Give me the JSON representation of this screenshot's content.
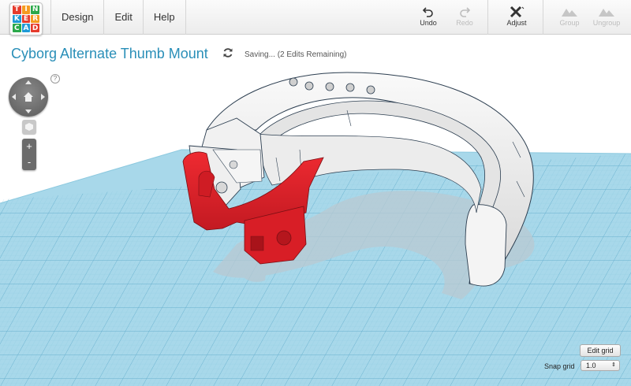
{
  "logo": {
    "letters": [
      "T",
      "I",
      "N",
      "K",
      "E",
      "R",
      "C",
      "A",
      "D"
    ],
    "colors": [
      "#e53b2c",
      "#f59b20",
      "#2aa84a",
      "#1f9ad6",
      "#e53b2c",
      "#f59b20",
      "#2aa84a",
      "#1f9ad6",
      "#e53b2c"
    ]
  },
  "menu": {
    "items": [
      {
        "label": "Design"
      },
      {
        "label": "Edit"
      },
      {
        "label": "Help"
      }
    ]
  },
  "toolbar": {
    "undo_label": "Undo",
    "redo_label": "Redo",
    "adjust_label": "Adjust",
    "group_label": "Group",
    "ungroup_label": "Ungroup"
  },
  "document": {
    "title": "Cyborg Alternate Thumb Mount",
    "status": "Saving... (2 Edits Remaining)"
  },
  "view": {
    "help": "?",
    "zoom_in": "+",
    "zoom_out": "-"
  },
  "grid": {
    "edit_grid_label": "Edit grid",
    "snap_label": "Snap grid",
    "snap_value": "1.0"
  },
  "colors": {
    "accent": "#2a8fb8",
    "grid_plane": "#a8d8ea",
    "grid_lines": "#78bcd8",
    "selected_part": "#e0202a",
    "model": "#f2f2f2"
  }
}
